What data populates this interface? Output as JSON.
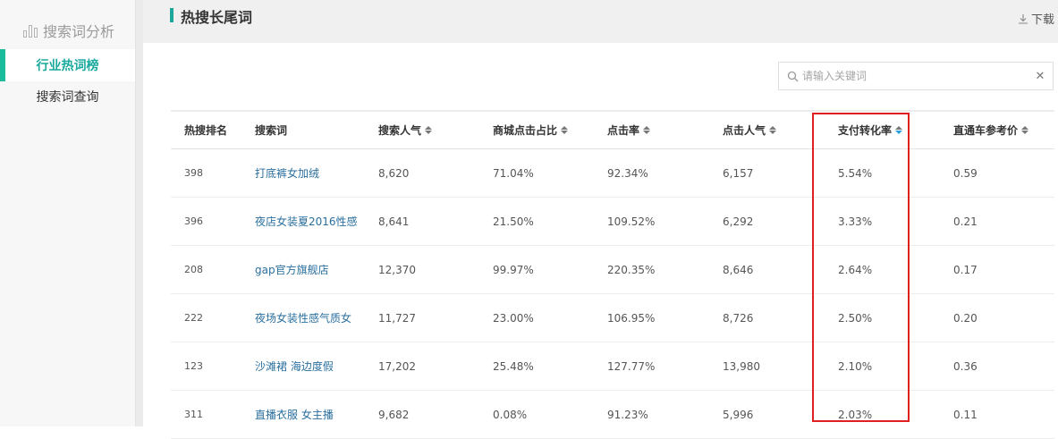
{
  "sidebar": {
    "title": "搜索词分析",
    "items": [
      {
        "label": "行业热词榜",
        "active": true
      },
      {
        "label": "搜索词查询",
        "active": false
      }
    ]
  },
  "header": {
    "title": "热搜长尾词",
    "download_label": "下载"
  },
  "search": {
    "placeholder": "请输入关键词",
    "value": ""
  },
  "table": {
    "columns": [
      "热搜排名",
      "搜索词",
      "搜索人气",
      "商城点击占比",
      "点击率",
      "点击人气",
      "支付转化率",
      "直通车参考价"
    ],
    "rows": [
      [
        "398",
        "打底裤女加绒",
        "8,620",
        "71.04%",
        "92.34%",
        "6,157",
        "5.54%",
        "0.59"
      ],
      [
        "396",
        "夜店女装夏2016性感",
        "8,641",
        "21.50%",
        "109.52%",
        "6,292",
        "3.33%",
        "0.21"
      ],
      [
        "208",
        "gap官方旗舰店",
        "12,370",
        "99.97%",
        "220.35%",
        "8,646",
        "2.64%",
        "0.17"
      ],
      [
        "222",
        "夜场女装性感气质女",
        "11,727",
        "23.00%",
        "106.95%",
        "8,726",
        "2.50%",
        "0.20"
      ],
      [
        "123",
        "沙滩裙 海边度假",
        "17,202",
        "25.48%",
        "127.77%",
        "13,980",
        "2.10%",
        "0.36"
      ],
      [
        "311",
        "直播衣服 女主播",
        "9,682",
        "0.08%",
        "91.23%",
        "5,996",
        "2.03%",
        "0.11"
      ]
    ]
  },
  "colors": {
    "accent": "#1abc9c",
    "link": "#2a6f9e",
    "highlight": "#e02020"
  }
}
